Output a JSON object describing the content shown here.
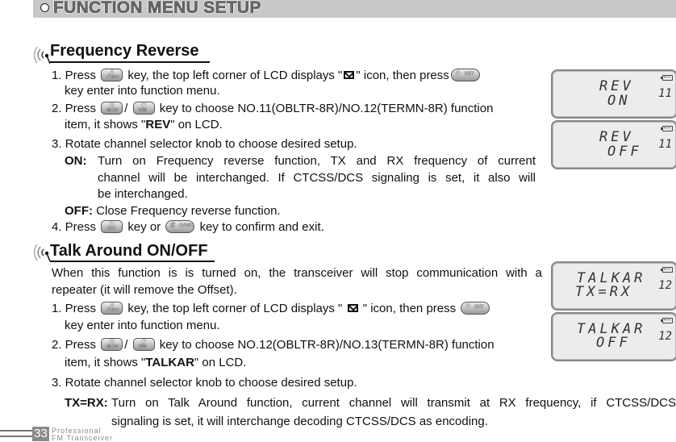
{
  "header": {
    "title": "FUNCTION MENU SETUP"
  },
  "section1": {
    "title": "Frequency Reverse",
    "step1_a": "1. Press",
    "step1_b": "key, the top left corner of LCD displays \"",
    "step1_c": "\" icon, then press",
    "step1_d": "key enter into function menu.",
    "step2_a": "2. Press",
    "step2_sep": "/",
    "step2_b": "key to choose NO.11(OBLTR-8R)/NO.12(TERMN-8R) function",
    "step2_c": "item, it shows \"",
    "step2_bold": "REV",
    "step2_d": "\" on LCD.",
    "step3": "3. Rotate channel selector knob to choose desired setup.",
    "on_label": "ON:",
    "on_text1": "Turn on Frequency reverse function, TX and RX frequency of current",
    "on_text2": "channel will be interchanged. If CTCSS/DCS signaling is set, it also will",
    "on_text3": "be interchanged.",
    "off_label": "OFF:",
    "off_text": "Close Frequency reverse function.",
    "step4_a": "4. Press",
    "step4_b": "key or",
    "step4_c": "key to confirm and exit."
  },
  "section2": {
    "title": "Talk Around ON/OFF",
    "intro1": "When this function is is turned on, the transceiver will stop communication with a",
    "intro2": "repeater (it will remove the Offset).",
    "step1_a": "1. Press",
    "step1_b": "key, the top left corner of LCD displays \"",
    "step1_c": "\" icon, then press",
    "step1_d": "key enter into function menu.",
    "step2_a": "2. Press",
    "step2_sep": "/",
    "step2_b": "key to choose NO.12(OBLTR-8R)/NO.13(TERMN-8R) function",
    "step2_c": "item, it shows \"",
    "step2_bold": "TALKAR",
    "step2_d": "\" on LCD.",
    "step3": "3. Rotate channel selector knob to choose desired setup.",
    "txrx_label": "TX=RX:",
    "txrx_text1": "Turn on Talk Around function, current channel will transmit at RX frequency, if CTCSS/DCS",
    "txrx_text2": "signaling is set, it will interchange decoding CTCSS/DCS as encoding."
  },
  "keys": {
    "a": {
      "big": "A",
      "small": "FUNC"
    },
    "b": {
      "big": "B",
      "small": "MAIN"
    },
    "c": {
      "big": "C",
      "small": "V/M"
    },
    "d": {
      "big": "D",
      "small": "ESC"
    },
    "eight": {
      "big": "8",
      "small": "SET"
    },
    "hash": {
      "big": "#",
      "small": "BANK"
    }
  },
  "icons": {
    "mail": "envelope-icon"
  },
  "lcds": [
    {
      "line1": "REV",
      "line2": "ON",
      "channel": "11"
    },
    {
      "line1": "REV",
      "line2": "OFF",
      "channel": "11"
    },
    {
      "line1": "TALKAR",
      "line2": "TX=RX",
      "channel": "12"
    },
    {
      "line1": "TALKAR",
      "line2": "OFF",
      "channel": "12"
    }
  ],
  "footer": {
    "page_number": "33",
    "line1": "Professional",
    "line2": "FM Transceiver"
  }
}
